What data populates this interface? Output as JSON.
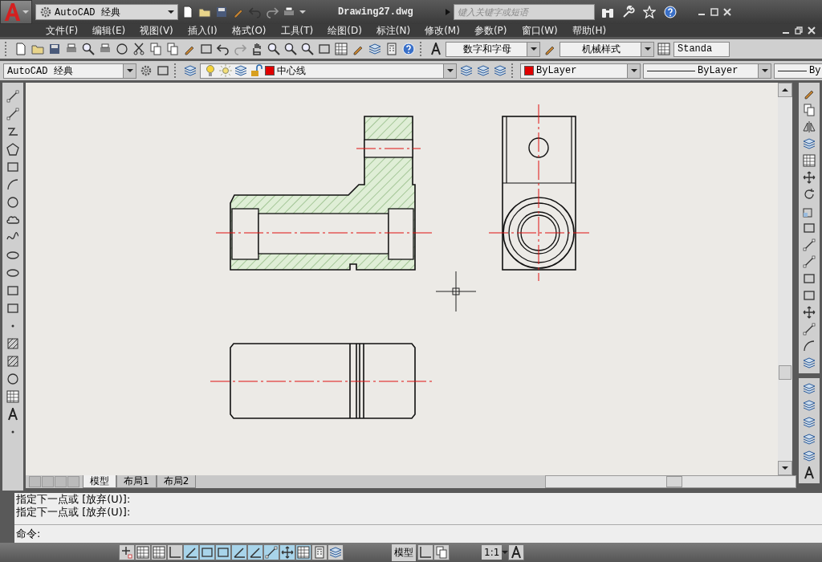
{
  "title_bar": {
    "workspace": "AutoCAD 经典",
    "title": "Drawing27.dwg",
    "search": {
      "placeholder": "键入关键字或短语"
    }
  },
  "menu": [
    "文件(F)",
    "编辑(E)",
    "视图(V)",
    "插入(I)",
    "格式(O)",
    "工具(T)",
    "绘图(D)",
    "标注(N)",
    "修改(M)",
    "参数(P)",
    "窗口(W)",
    "帮助(H)"
  ],
  "styles_toolbar": {
    "text_style": "数字和字母",
    "dim_style": "机械样式",
    "table_style": "Standa"
  },
  "properties_toolbar": {
    "workspace": "AutoCAD 经典",
    "layer": {
      "name": "中心线",
      "color": "#e00000"
    },
    "color": {
      "name": "ByLayer",
      "color": "#e00000"
    },
    "linetype": "ByLayer",
    "lineweight": "By"
  },
  "layout_tabs": [
    {
      "label": "模型",
      "selected": true
    },
    {
      "label": "布局1",
      "selected": false
    },
    {
      "label": "布局2",
      "selected": false
    }
  ],
  "command_history": [
    "指定下一点或 [放弃(U)]:",
    "指定下一点或 [放弃(U)]:"
  ],
  "command_prompt": "命令:",
  "status_bar": {
    "toggles": [
      {
        "on": false
      },
      {
        "on": false
      },
      {
        "on": false
      },
      {
        "on": false
      },
      {
        "on": true
      },
      {
        "on": true
      },
      {
        "on": true
      },
      {
        "on": true
      },
      {
        "on": true
      },
      {
        "on": true
      },
      {
        "on": true
      },
      {
        "on": true
      },
      {
        "on": false
      },
      {
        "on": false
      }
    ],
    "space": "模型",
    "annotation_scale": "1:1"
  }
}
